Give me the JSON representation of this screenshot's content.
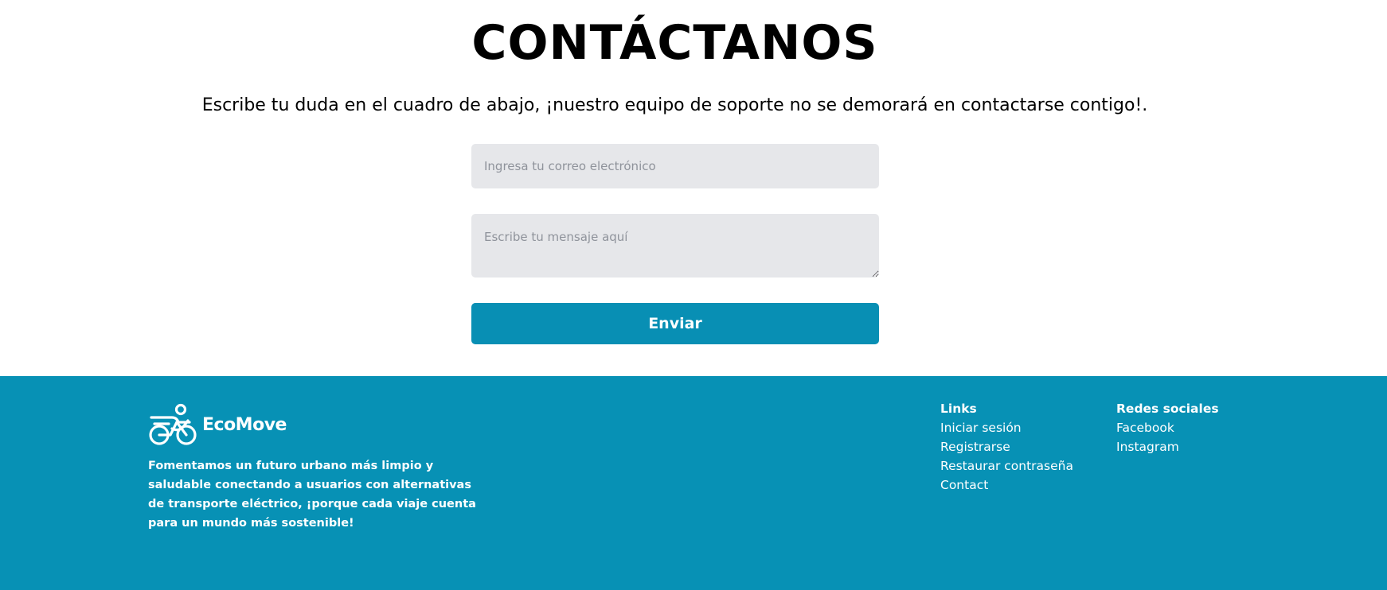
{
  "contact": {
    "title": "CONTÁCTANOS",
    "subtitle": "Escribe tu duda en el cuadro de abajo, ¡nuestro equipo de soporte no se demorará en contactarse contigo!.",
    "email_placeholder": "Ingresa tu correo electrónico",
    "message_placeholder": "Escribe tu mensaje aquí",
    "send_label": "Enviar"
  },
  "footer": {
    "brand_name": "EcoMove",
    "brand_icon": "bike-rider-icon",
    "tagline": "Fomentamos un futuro urbano más limpio y saludable conectando a usuarios con alternativas de transporte eléctrico, ¡porque cada viaje cuenta para un mundo más sostenible!",
    "links": {
      "title": "Links",
      "items": [
        "Iniciar sesión",
        "Registrarse",
        "Restaurar contraseña",
        "Contact"
      ]
    },
    "social": {
      "title": "Redes sociales",
      "items": [
        "Facebook",
        "Instagram"
      ]
    }
  },
  "colors": {
    "accent": "#088fb4",
    "footer_bg": "#0791b5",
    "input_bg": "#e6e7ea"
  }
}
